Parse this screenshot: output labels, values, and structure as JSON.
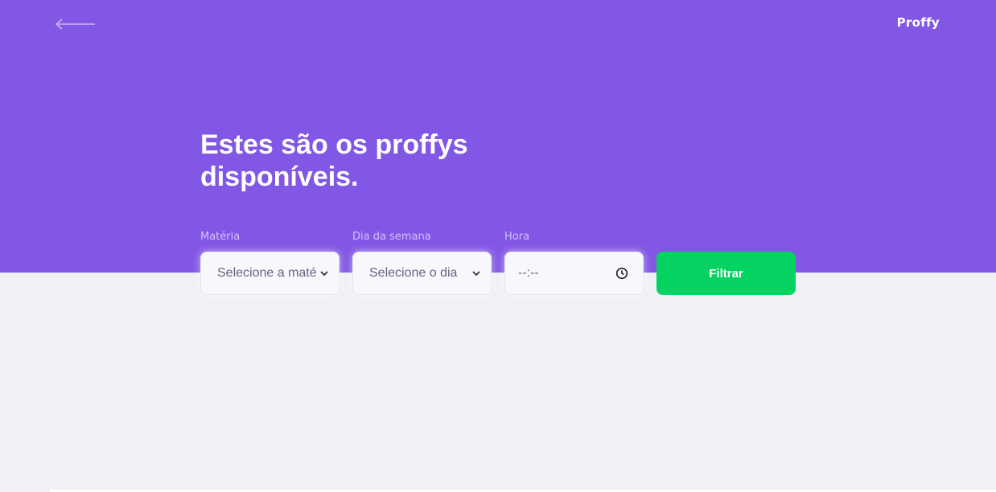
{
  "header": {
    "logo": "Proffy",
    "back_icon": "arrow-left-icon",
    "title_line1": "Estes são os proffys",
    "title_line2": "disponíveis."
  },
  "filters": {
    "subject": {
      "label": "Matéria",
      "value": "Selecione a maté"
    },
    "weekday": {
      "label": "Dia da semana",
      "value": "Selecione o dia"
    },
    "time": {
      "label": "Hora",
      "value": "--:--"
    },
    "submit_label": "Filtrar"
  },
  "colors": {
    "primary": "#8257e5",
    "background": "#f0f0f7",
    "button": "#04d361",
    "label": "#d4c2ff",
    "input_bg": "#f8f8fc"
  }
}
